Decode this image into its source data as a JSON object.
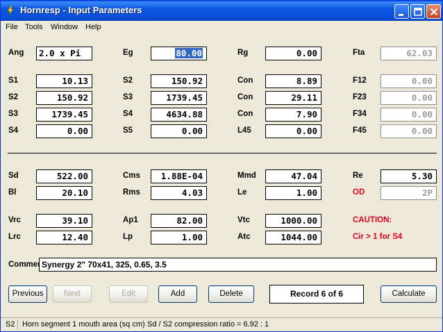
{
  "window": {
    "title": "Hornresp - Input Parameters"
  },
  "menu": [
    "File",
    "Tools",
    "Window",
    "Help"
  ],
  "labels": {
    "ang": "Ang",
    "eg": "Eg",
    "rg": "Rg",
    "fta": "Fta",
    "s1": "S1",
    "s2a": "S2",
    "con1": "Con",
    "f12": "F12",
    "s2": "S2",
    "s3a": "S3",
    "con2": "Con",
    "f23": "F23",
    "s3": "S3",
    "s4a": "S4",
    "con3": "Con",
    "f34": "F34",
    "s4": "S4",
    "s5": "S5",
    "l45": "L45",
    "f45": "F45",
    "sd": "Sd",
    "cms": "Cms",
    "mmd": "Mmd",
    "re": "Re",
    "bl": "Bl",
    "rms": "Rms",
    "le": "Le",
    "od": "OD",
    "vrc": "Vrc",
    "ap1": "Ap1",
    "vtc": "Vtc",
    "caution": "CAUTION:",
    "lrc": "Lrc",
    "lp": "Lp",
    "atc": "Atc",
    "caution_msg": "Cir > 1 for S4",
    "comment": "Comment"
  },
  "values": {
    "ang": "2.0 x Pi",
    "eg": "80.00",
    "rg": "0.00",
    "fta": "62.03",
    "s1": "10.13",
    "s2a": "150.92",
    "con1": "8.89",
    "f12": "0.00",
    "s2": "150.92",
    "s3a": "1739.45",
    "con2": "29.11",
    "f23": "0.00",
    "s3": "1739.45",
    "s4a": "4634.88",
    "con3": "7.90",
    "f34": "0.00",
    "s4": "0.00",
    "s5": "0.00",
    "l45": "0.00",
    "f45": "0.00",
    "sd": "522.00",
    "cms": "1.88E-04",
    "mmd": "47.04",
    "re": "5.30",
    "bl": "20.10",
    "rms": "4.03",
    "le": "1.00",
    "od": "2P",
    "vrc": "39.10",
    "ap1": "82.00",
    "vtc": "1000.00",
    "lrc": "12.40",
    "lp": "1.00",
    "atc": "1044.00"
  },
  "comment": "Synergy 2\" 70x41, 325, 0.65, 3.5",
  "buttons": {
    "previous": "Previous",
    "next": "Next",
    "edit": "Edit",
    "add": "Add",
    "delete": "Delete",
    "calculate": "Calculate"
  },
  "record": "Record 6 of 6",
  "status": {
    "field": "S2",
    "description": "Horn segment 1 mouth area  (sq cm)",
    "ratio": "Sd / S2 compression ratio = 6.92 : 1"
  },
  "colors": {
    "title_bar": "#0a5fe6",
    "caution": "#e8001c",
    "selection": "#316ac5"
  }
}
